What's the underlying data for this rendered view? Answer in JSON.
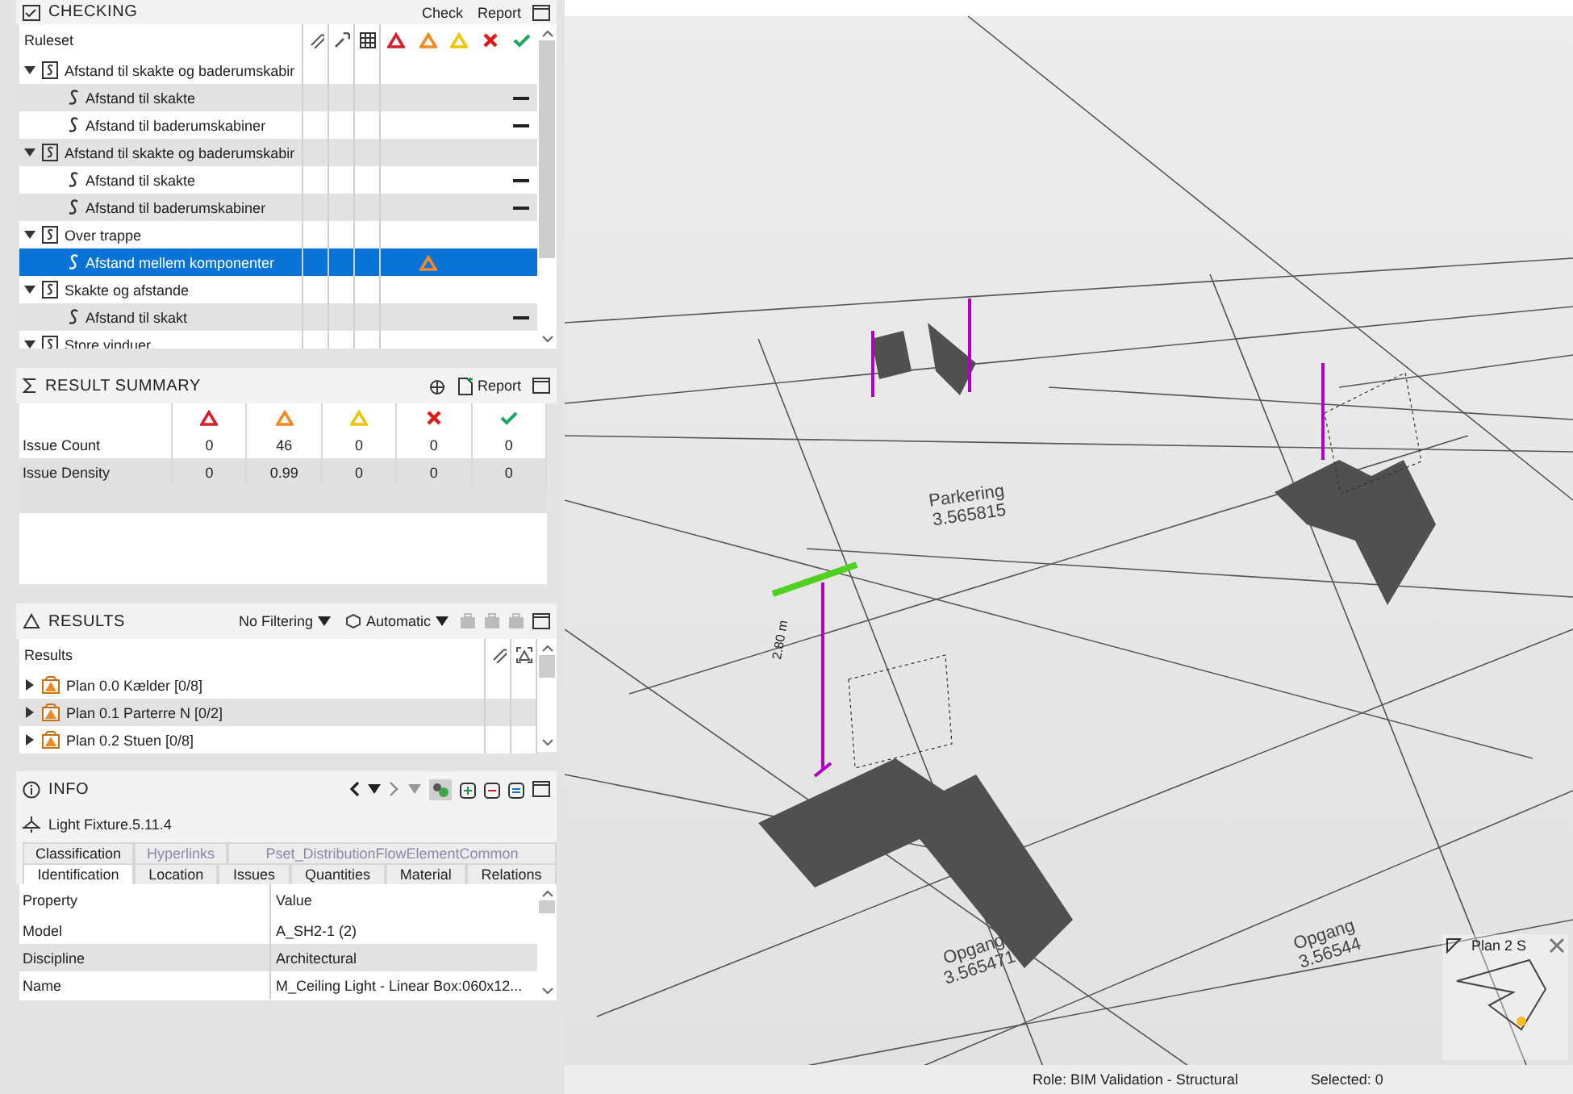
{
  "checking": {
    "title": "CHECKING",
    "buttons": [
      "Check",
      "Report"
    ],
    "column": "Ruleset",
    "severities": [
      {
        "kind": "critical"
      },
      {
        "kind": "moderate"
      },
      {
        "kind": "low"
      },
      {
        "kind": "error"
      },
      {
        "kind": "passed"
      }
    ],
    "rules": [
      {
        "label": "Afstand til skakte og baderumskabir",
        "expanded": true,
        "selected": false,
        "children": [
          {
            "label": "Afstand til skakte",
            "kind": "dash",
            "selected": false
          },
          {
            "label": "Afstand til baderumskabiner",
            "kind": "dash",
            "selected": false
          }
        ]
      },
      {
        "label": "Afstand til skakte og baderumskabir",
        "expanded": true,
        "selected": false,
        "children": [
          {
            "label": "Afstand til skakte",
            "kind": "dash",
            "selected": false
          },
          {
            "label": "Afstand til baderumskabiner",
            "kind": "dash",
            "selected": false
          }
        ]
      },
      {
        "label": "Over trappe",
        "expanded": true,
        "selected": false,
        "children": [
          {
            "label": "Afstand mellem komponenter",
            "kind": "moderate",
            "selected": true
          }
        ]
      },
      {
        "label": "Skakte og afstande",
        "expanded": true,
        "selected": false,
        "children": [
          {
            "label": "Afstand til skakt",
            "kind": "dash",
            "selected": false
          }
        ]
      },
      {
        "label": "Store vinduer",
        "expanded": true,
        "selected": false
      }
    ]
  },
  "summary": {
    "title": "RESULT SUMMARY",
    "report": "Report",
    "rows": [
      {
        "label": "Issue Count",
        "values": [
          "0",
          "46",
          "0",
          "0",
          "0"
        ]
      },
      {
        "label": "Issue Density",
        "values": [
          "0",
          "0.99",
          "0",
          "0",
          "0"
        ]
      }
    ]
  },
  "results": {
    "title": "RESULTS",
    "filter": "No Filtering",
    "mode": "Automatic",
    "column": "Results",
    "rows": [
      {
        "label": "Plan 0.0 Kælder [0/8]",
        "expanded": false
      },
      {
        "label": "Plan 0.1 Parterre N [0/2]",
        "expanded": false
      },
      {
        "label": "Plan 0.2 Stuen [0/8]",
        "expanded": false
      }
    ]
  },
  "info": {
    "title": "INFO",
    "object": "Light Fixture.5.11.4",
    "tabs_back": [
      {
        "label": "Classification",
        "disabled": false
      },
      {
        "label": "Hyperlinks",
        "disabled": true
      },
      {
        "label": "Pset_DistributionFlowElementCommon",
        "disabled": true
      }
    ],
    "tabs": [
      {
        "label": "Identification",
        "selected": true
      },
      {
        "label": "Location",
        "selected": false
      },
      {
        "label": "Issues",
        "selected": false
      },
      {
        "label": "Quantities",
        "selected": false
      },
      {
        "label": "Material",
        "selected": false
      },
      {
        "label": "Relations",
        "selected": false
      }
    ],
    "columns": [
      "Property",
      "Value"
    ],
    "rows": [
      {
        "property": "Model",
        "value": "A_SH2-1 (2)"
      },
      {
        "property": "Discipline",
        "value": "Architectural"
      },
      {
        "property": "Name",
        "value": "M_Ceiling Light - Linear Box:060x12..."
      }
    ]
  },
  "viewport": {
    "labels": [
      {
        "kind": "space",
        "text": "Parkering\n3.565815"
      },
      {
        "kind": "space",
        "text": "Opgang\n3.565471"
      },
      {
        "kind": "space",
        "text": "Opgang\n3.56544"
      },
      {
        "kind": "dimension",
        "text": "2.80 m"
      }
    ],
    "minimap": {
      "title": "Plan 2 S"
    }
  },
  "status_bar": {
    "role": "Role: BIM Validation - Structural",
    "selected": "Selected: 0"
  }
}
